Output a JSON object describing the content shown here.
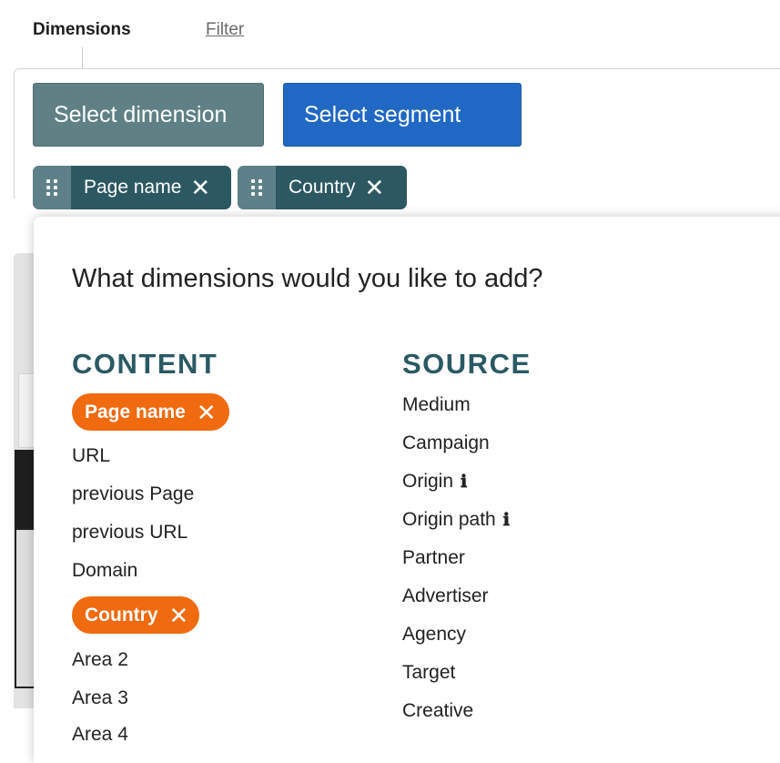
{
  "tabs": {
    "dimensions": "Dimensions",
    "filter": "Filter"
  },
  "buttons": {
    "select_dimension": "Select dimension",
    "select_segment": "Select segment"
  },
  "selected_chips": [
    {
      "label": "Page name",
      "remove": "✕"
    },
    {
      "label": "Country",
      "remove": "✕"
    }
  ],
  "modal": {
    "title": "What dimensions would you like to add?",
    "content": {
      "heading": "CONTENT",
      "items": [
        {
          "label": "Page name",
          "selected": true
        },
        {
          "label": "URL"
        },
        {
          "label": "previous Page"
        },
        {
          "label": "previous URL"
        },
        {
          "label": "Domain"
        },
        {
          "label": "Country",
          "selected": true
        },
        {
          "label": "Area 2"
        },
        {
          "label": "Area 3"
        },
        {
          "label": "Area 4"
        }
      ]
    },
    "source": {
      "heading": "SOURCE",
      "items": [
        {
          "label": "Medium"
        },
        {
          "label": "Campaign"
        },
        {
          "label": "Origin",
          "info": "ℹ"
        },
        {
          "label": "Origin path",
          "info": "ℹ"
        },
        {
          "label": "Partner"
        },
        {
          "label": "Advertiser"
        },
        {
          "label": "Agency"
        },
        {
          "label": "Target"
        },
        {
          "label": "Creative"
        }
      ]
    },
    "remove_glyph": "✕"
  },
  "colors": {
    "dimension_button": "#5f8185",
    "segment_button": "#2068c4",
    "chip_bg": "#2c5862",
    "chip_handle": "#5e8189",
    "selected_pill": "#f06a0f",
    "heading": "#2a5a64"
  }
}
